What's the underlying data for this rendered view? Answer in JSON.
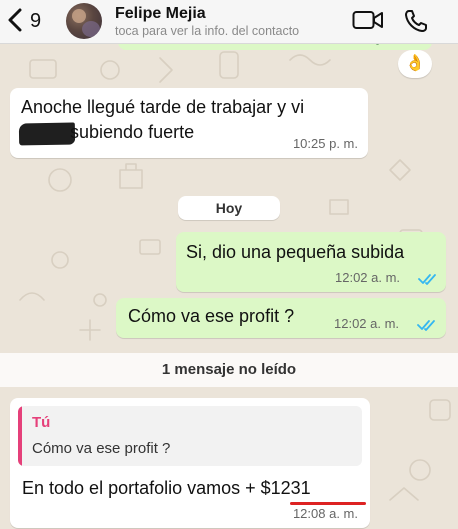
{
  "header": {
    "back_count": "9",
    "contact_name": "Felipe Mejia",
    "contact_subtitle": "toca para ver la info. del contacto"
  },
  "reaction": {
    "emoji": "👌"
  },
  "messages": [
    {
      "direction": "incoming",
      "line1": "Anoche llegué tarde de trabajar y vi",
      "line2": "subiendo fuerte",
      "time": "10:25 p. m."
    },
    {
      "direction": "outgoing",
      "text": "Si, dio una pequeña subida",
      "time": "12:02 a. m.",
      "status": "read"
    },
    {
      "direction": "outgoing",
      "text": "Cómo va ese profit ?",
      "time": "12:02 a. m.",
      "status": "read"
    },
    {
      "direction": "incoming",
      "quote_author": "Tú",
      "quote_text": "Cómo va ese profit ?",
      "text": "En todo el portafolio vamos + $1231",
      "time": "12:08 a. m."
    }
  ],
  "date_separator": "Hoy",
  "unread_banner": "1 mensaje no leído",
  "colors": {
    "outgoing_bubble": "#dcf8c6",
    "incoming_bubble": "#ffffff",
    "read_ticks": "#34b7f1",
    "quote_accent": "#e5407a",
    "underline": "#dd2222"
  },
  "icons": [
    "back-chevron-icon",
    "video-call-icon",
    "phone-call-icon",
    "double-check-icon"
  ]
}
